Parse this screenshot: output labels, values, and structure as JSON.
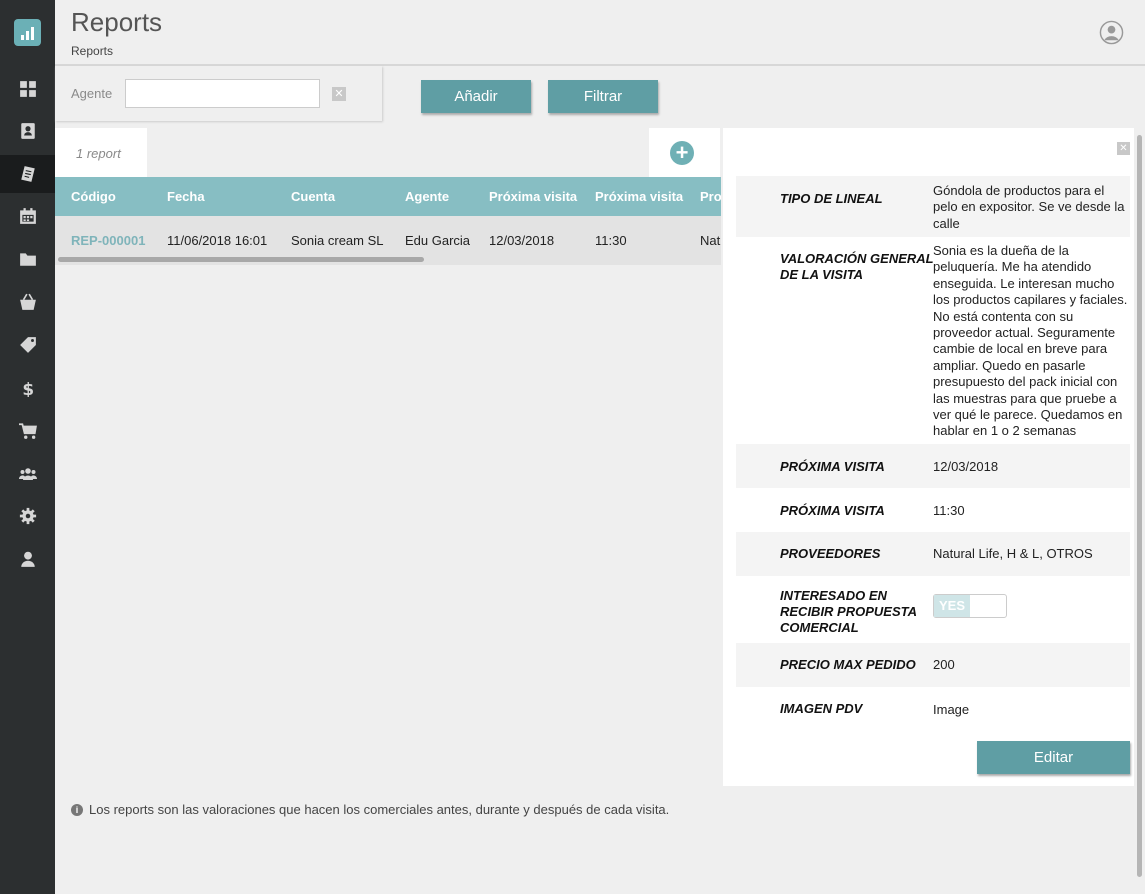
{
  "header": {
    "title": "Reports",
    "breadcrumb": "Reports"
  },
  "sidebar": {
    "items": [
      {
        "icon": "dashboard-grid-icon",
        "active": false
      },
      {
        "icon": "contacts-book-icon",
        "active": false
      },
      {
        "icon": "reports-icon",
        "active": true
      },
      {
        "icon": "calendar-icon",
        "active": false
      },
      {
        "icon": "folder-icon",
        "active": false
      },
      {
        "icon": "basket-icon",
        "active": false
      },
      {
        "icon": "tag-icon",
        "active": false
      },
      {
        "icon": "dollar-icon",
        "active": false
      },
      {
        "icon": "cart-icon",
        "active": false
      },
      {
        "icon": "users-group-icon",
        "active": false
      },
      {
        "icon": "gear-icon",
        "active": false
      },
      {
        "icon": "user-icon",
        "active": false
      }
    ]
  },
  "filter": {
    "label": "Agente",
    "value": "",
    "clear": "✕"
  },
  "toolbar": {
    "add_label": "Añadir",
    "filter_label": "Filtrar",
    "plus": "+"
  },
  "table": {
    "count": "1 report",
    "headers": [
      "Código",
      "Fecha",
      "Cuenta",
      "Agente",
      "Próxima visita",
      "Próxima visita",
      "Pro"
    ],
    "rows": [
      [
        "REP-000001",
        "11/06/2018 16:01",
        "Sonia cream SL",
        "Edu Garcia",
        "12/03/2018",
        "11:30",
        "Nat"
      ]
    ]
  },
  "detail": {
    "close": "✕",
    "fields": [
      {
        "label": "TIPO DE LINEAL",
        "value": "Góndola de productos para el pelo en expositor. Se ve desde la calle"
      },
      {
        "label": "VALORACIÓN GENERAL DE LA VISITA",
        "value": "Sonia es la dueña de la peluquería. Me ha atendido enseguida. Le interesan mucho los productos capilares y faciales. No está contenta con su proveedor actual. Seguramente cambie de local en breve para ampliar. Quedo en pasarle presupuesto del pack inicial con las muestras para que pruebe a ver qué le parece. Quedamos en hablar en 1 o 2 semanas"
      },
      {
        "label": "PRÓXIMA VISITA",
        "value": "12/03/2018"
      },
      {
        "label": "PRÓXIMA VISITA",
        "value": "11:30"
      },
      {
        "label": "PROVEEDORES",
        "value": "Natural Life, H & L, OTROS"
      },
      {
        "label": "INTERESADO EN RECIBIR PROPUESTA COMERCIAL",
        "value": "YES"
      },
      {
        "label": "PRECIO MAX PEDIDO",
        "value": "200"
      },
      {
        "label": "IMAGEN PDV",
        "value": "Image"
      }
    ],
    "edit_label": "Editar"
  },
  "footer": {
    "info_icon": "i",
    "note": "Los reports son las valoraciones que hacen los comerciales antes, durante y después de cada visita."
  },
  "colors": {
    "sidebar": "#2c2f30",
    "accent": "#5f9ea4",
    "table_header": "#87bec3",
    "link": "#7fb4ba"
  }
}
